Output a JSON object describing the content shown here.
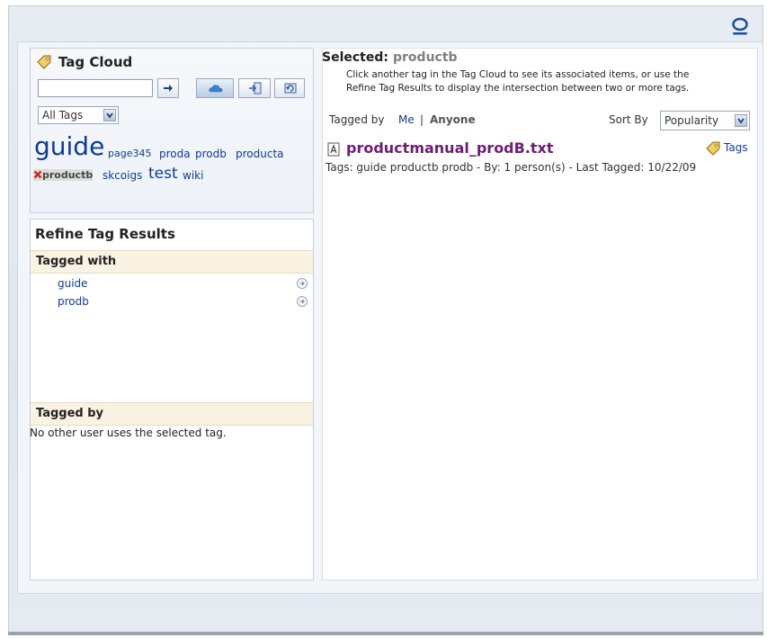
{
  "tag_cloud": {
    "title": "Tag Cloud",
    "search_value": "",
    "filter_select": "All Tags",
    "tags": [
      {
        "label": "guide"
      },
      {
        "label": "page345"
      },
      {
        "label": "proda"
      },
      {
        "label": "prodb"
      },
      {
        "label": "producta"
      },
      {
        "label": "productb",
        "selected": true
      },
      {
        "label": "skcoigs"
      },
      {
        "label": "test"
      },
      {
        "label": "wiki"
      }
    ]
  },
  "refine": {
    "title": "Refine Tag Results",
    "tagged_with_header": "Tagged with",
    "tagged_with_items": [
      "guide",
      "prodb"
    ],
    "tagged_by_header": "Tagged by",
    "tagged_by_message": "No other user uses the selected tag."
  },
  "selected": {
    "label": "Selected:",
    "tag": "productb",
    "help_line1": "Click another tag in the Tag Cloud to see its associated items, or use the",
    "help_line2": "Refine Tag Results to display the intersection between two or more tags.",
    "tagged_by_label": "Tagged by",
    "me": "Me",
    "separator": "|",
    "anyone": "Anyone",
    "sort_by_label": "Sort By",
    "sort_value": "Popularity"
  },
  "result": {
    "title": "productmanual_prodB.txt",
    "tags_link": "Tags",
    "meta": "Tags: guide productb prodb - By: 1 person(s) - Last Tagged: 10/22/09"
  },
  "colors": {
    "link": "#0e3d92",
    "result_title": "#6b1e74",
    "selected_tag": "#7f7f7f",
    "remove_x": "#cc2a1e"
  }
}
